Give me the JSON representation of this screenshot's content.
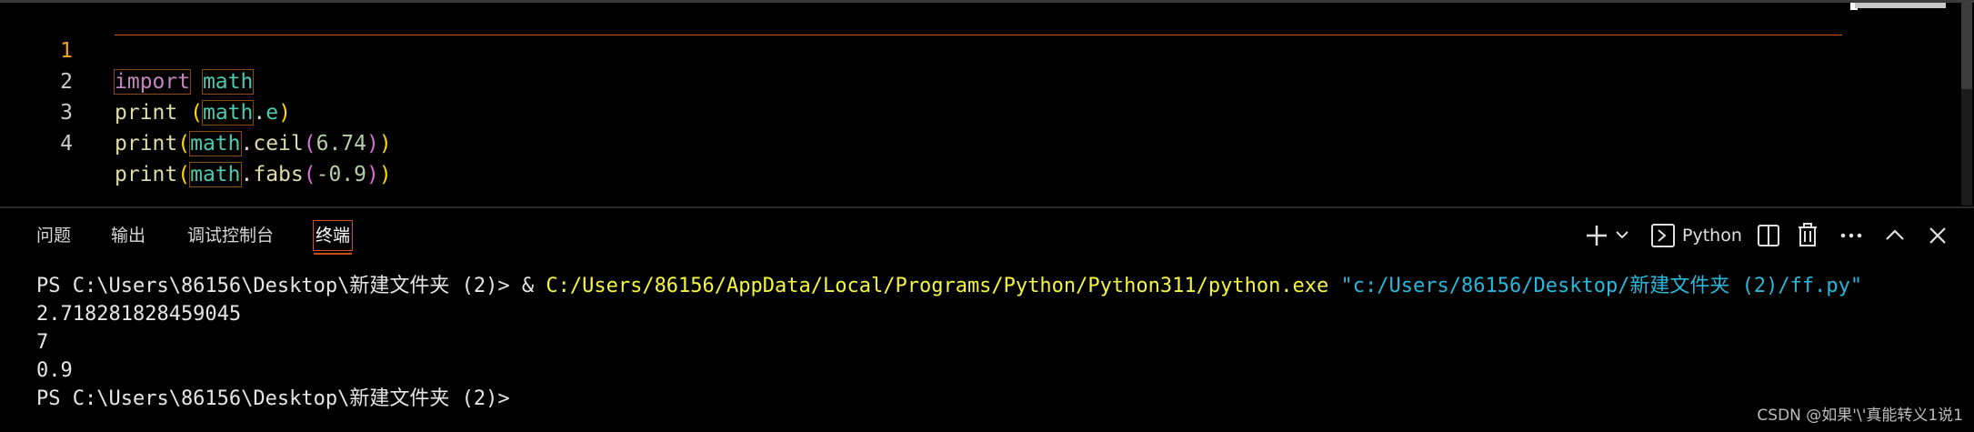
{
  "editor": {
    "line_numbers": [
      "1",
      "2",
      "3",
      "4"
    ],
    "active_line": 1,
    "lines": [
      {
        "kw": "import",
        "mod": "math"
      },
      {
        "fn": "print",
        "open": "(",
        "mod": "math",
        "dot": ".",
        "attr": "e",
        "close": ")"
      },
      {
        "fn": "print",
        "open": "(",
        "mod": "math",
        "dot": ".",
        "attr": "ceil",
        "open2": "(",
        "num": "6.74",
        "close2": ")",
        "close": ")"
      },
      {
        "fn": "print",
        "open": "(",
        "mod": "math",
        "dot": ".",
        "attr": "fabs",
        "open2": "(",
        "num": "-0.9",
        "close2": ")",
        "close": ")"
      }
    ]
  },
  "panel": {
    "tabs": [
      {
        "label": "问题"
      },
      {
        "label": "输出"
      },
      {
        "label": "调试控制台"
      },
      {
        "label": "终端",
        "active": true
      }
    ],
    "actions": {
      "add_icon": "plus-icon",
      "dropdown_icon": "chevron-down-icon",
      "terminal_icon": "terminal-icon",
      "shell_label": "Python",
      "split_icon": "split-icon",
      "trash_icon": "trash-icon",
      "more_icon": "more-icon",
      "maximize_icon": "chevron-up-icon",
      "close_icon": "close-icon"
    }
  },
  "terminal": {
    "prompt1": "PS C:\\Users\\86156\\Desktop\\新建文件夹 (2)> ",
    "amp": "& ",
    "exe": "C:/Users/86156/AppData/Local/Programs/Python/Python311/python.exe",
    "space": " ",
    "script_arg": "\"c:/Users/86156/Desktop/新建文件夹 (2)/ff.py\"",
    "output": [
      "2.718281828459045",
      "7",
      "0.9"
    ],
    "prompt2": "PS C:\\Users\\86156\\Desktop\\新建文件夹 (2)>"
  },
  "watermark": "CSDN @如果'\\'真能转义1说1",
  "colors": {
    "background": "#000000",
    "accent": "#c8501a",
    "keyword": "#c586c0",
    "module": "#4ec9b0",
    "function": "#dcdcaa",
    "number": "#b5cea8",
    "terminal_yellow": "#f5f543",
    "terminal_cyan": "#29b8db"
  }
}
